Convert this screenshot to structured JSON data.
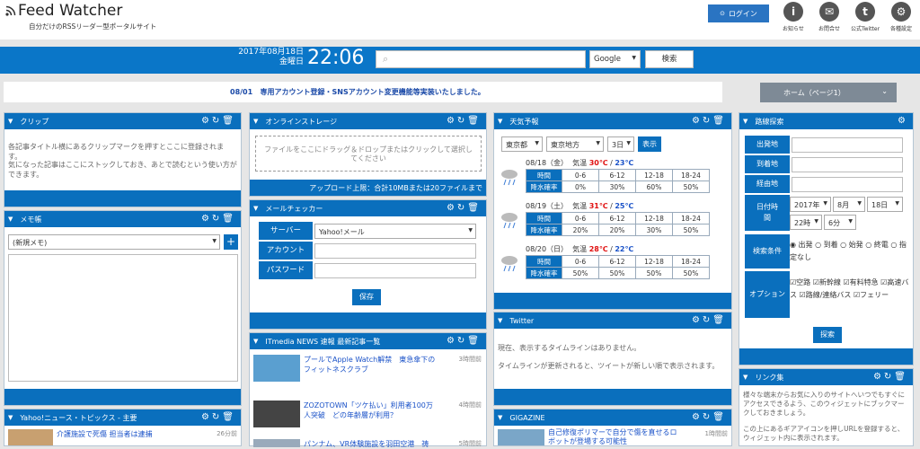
{
  "header": {
    "app_name": "Feed Watcher",
    "tagline": "自分だけのRSSリーダー型ポータルサイト",
    "login_label": "ログイン",
    "icons": [
      {
        "name": "info-icon",
        "glyph": "i",
        "label": "お知らせ"
      },
      {
        "name": "mail-icon",
        "glyph": "✉",
        "label": "お問合せ"
      },
      {
        "name": "twitter-icon",
        "glyph": "t",
        "label": "公式Twitter"
      },
      {
        "name": "gear-icon",
        "glyph": "⚙",
        "label": "各種設定"
      }
    ]
  },
  "topbar": {
    "date": "2017年08月18日",
    "weekday": "金曜日",
    "time": "22:06",
    "search_placeholder": "",
    "engine": "Google",
    "search_button": "検索"
  },
  "notice": {
    "date": "08/01",
    "text": "専用アカウント登録・SNSアカウント変更機能等実装いたしました。"
  },
  "home_select": "ホーム（ページ1）",
  "clip": {
    "title": "クリップ",
    "line1": "各記事タイトル横にあるクリップマークを押すとここに登録されます。",
    "line2": "気になった記事はここにストックしておき、あとで読むという使い方ができます。"
  },
  "memo": {
    "title": "メモ帳",
    "select": "(新規メモ)",
    "add": "+"
  },
  "yahoo": {
    "title": "Yahoo!ニュース・トピックス - 主要",
    "item": "介護施設で死傷 担当者は逮捕",
    "time": "26分前"
  },
  "storage": {
    "title": "オンラインストレージ",
    "drop_text": "ファイルをここにドラッグ＆ドロップまたはクリックして選択してください",
    "limit": "アップロード上限：合計10MBまたは20ファイルまで"
  },
  "mail": {
    "title": "メールチェッカー",
    "server_label": "サーバー",
    "server_value": "Yahoo!メール",
    "account_label": "アカウント",
    "password_label": "パスワード",
    "save": "保存"
  },
  "itmedia": {
    "title": "ITmedia NEWS 速報 最新記事一覧",
    "items": [
      {
        "title": "プールでApple Watch解禁　東急傘下のフィットネスクラブ",
        "time": "3時間前"
      },
      {
        "title": "ZOZOTOWN「ツケ払い」利用者100万人突破　どの年齢層が利用？",
        "time": "4時間前"
      },
      {
        "title": "パンナム、VR体験施設を羽田空港　祷",
        "time": "5時間前"
      }
    ]
  },
  "weather": {
    "title": "天気予報",
    "pref": "東京都",
    "area": "東京地方",
    "days": "3日",
    "show": "表示",
    "rows": [
      {
        "date": "08/18（金）",
        "label": "気温",
        "hi": "30℃",
        "lo": "23℃",
        "times": [
          "0-6",
          "6-12",
          "12-18",
          "18-24"
        ],
        "rain": [
          "0%",
          "30%",
          "60%",
          "50%"
        ]
      },
      {
        "date": "08/19（土）",
        "label": "気温",
        "hi": "31℃",
        "lo": "25℃",
        "times": [
          "0-6",
          "6-12",
          "12-18",
          "18-24"
        ],
        "rain": [
          "20%",
          "20%",
          "30%",
          "50%"
        ]
      },
      {
        "date": "08/20（日）",
        "label": "気温",
        "hi": "28℃",
        "lo": "22℃",
        "times": [
          "0-6",
          "6-12",
          "12-18",
          "18-24"
        ],
        "rain": [
          "50%",
          "50%",
          "50%",
          "50%"
        ]
      }
    ],
    "time_label": "時間",
    "rain_label": "降水確率"
  },
  "twitter": {
    "title": "Twitter",
    "line1": "現在、表示するタイムラインはありません。",
    "line2": "タイムラインが更新されると、ツイートが新しい順で表示されます。"
  },
  "gigazine": {
    "title": "GIGAZINE",
    "item": "自己修復ポリマーで自分で傷を直せるロボットが登場する可能性",
    "time": "1時間前"
  },
  "route": {
    "title": "路線探索",
    "from": "出発地",
    "to": "到着地",
    "via": "経由地",
    "datetime": "日付時間",
    "year": "2017年",
    "month": "8月",
    "day": "18日",
    "hour": "22時",
    "minute": "6分",
    "cond_label": "検索条件",
    "conds": [
      "出発",
      "到着",
      "始発",
      "終電",
      "指定なし"
    ],
    "opt_label": "オプション",
    "opts": [
      "空路",
      "新幹線",
      "有料特急",
      "高速バス",
      "路線/連絡バス",
      "フェリー"
    ],
    "search": "探索"
  },
  "links": {
    "title": "リンク集",
    "line1": "様々な端末からお気に入りのサイトへいつでもすぐにアクセスできるよう、このウィジェットにブックマークしておきましょう。",
    "line2": "この上にあるギアアイコンを押しURLを登録すると、ウィジェット内に表示されます。"
  },
  "colors": {
    "primary": "#0a6fbd",
    "accent_red": "#e01010",
    "accent_blue": "#1a52c8"
  }
}
